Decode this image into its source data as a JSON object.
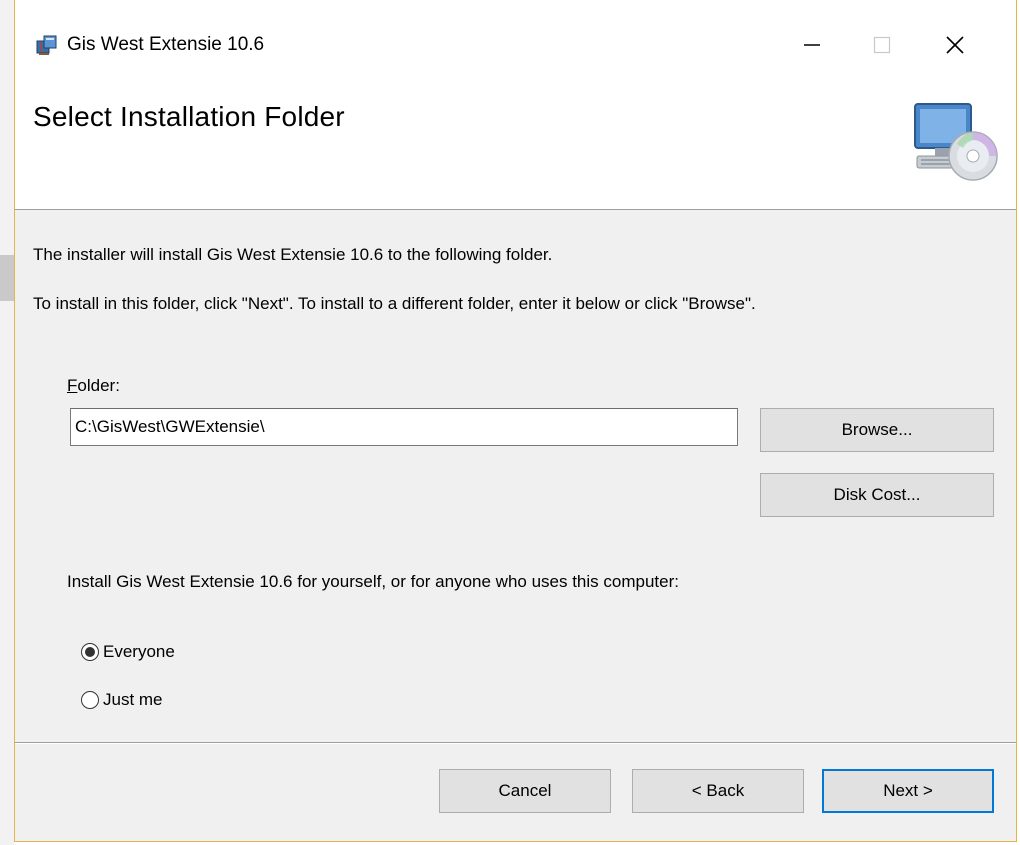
{
  "window": {
    "title": "Gis West Extensie 10.6",
    "controls": {
      "minimize": "—",
      "maximize": "☐",
      "close": "✕"
    }
  },
  "header": {
    "title": "Select Installation Folder",
    "icon": "computer-disc-icon"
  },
  "body": {
    "line1": "The installer will install Gis West Extensie 10.6 to the following folder.",
    "line2": "To install in this folder, click \"Next\". To install to a different folder, enter it below or click \"Browse\".",
    "folder_label_accel": "F",
    "folder_label_rest": "older:",
    "folder_value": "C:\\GisWest\\GWExtensie\\",
    "browse_label": "Browse...",
    "disk_cost_label": "Disk Cost...",
    "install_for_text": "Install Gis West Extensie 10.6 for yourself, or for anyone who uses this computer:",
    "radio_options": [
      {
        "label": "Everyone",
        "selected": true
      },
      {
        "label": "Just me",
        "selected": false
      }
    ]
  },
  "footer": {
    "cancel_label": "Cancel",
    "back_label": "< Back",
    "next_label": "Next >"
  },
  "colors": {
    "window_border": "#e6b24a",
    "dialog_bg": "#f0f0f0",
    "button_bg": "#e1e1e1",
    "default_button_border": "#0078d7"
  }
}
